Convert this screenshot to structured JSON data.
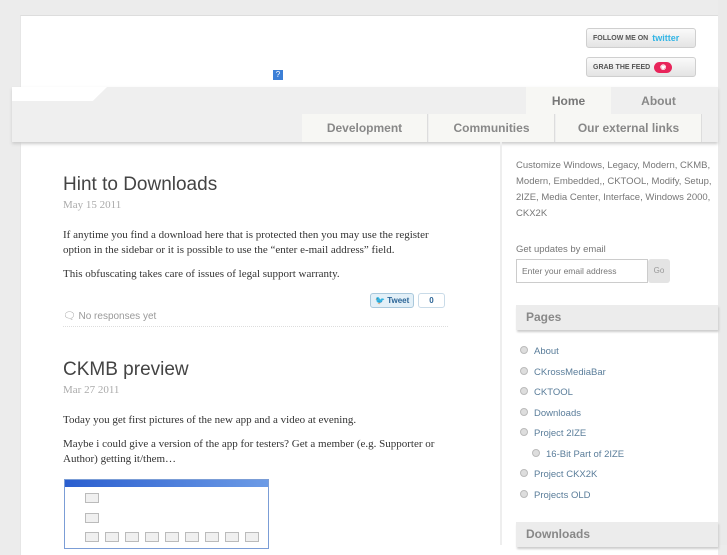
{
  "header": {
    "twitter_label": "FOLLOW ME ON",
    "twitter_brand": "twitter",
    "feed_label": "GRAB THE FEED",
    "feed_icon": "rss-icon",
    "broken_image": "?"
  },
  "nav": {
    "tabs": [
      "Home",
      "About"
    ],
    "subnav": [
      "Development",
      "Communities",
      "Our external links"
    ]
  },
  "posts": [
    {
      "title": "Hint to Downloads",
      "date": "May 15 2011",
      "paragraphs": [
        "If anytime you find a download here that is protected then you may use the register option in the sidebar or it is possible to use the “enter e-mail address” field.",
        "This obfuscating takes care of issues of legal support warranty."
      ],
      "tweet": "Tweet",
      "tweet_count": "0",
      "responses": "No responses yet"
    },
    {
      "title": "CKMB preview",
      "date": "Mar 27 2011",
      "paragraphs": [
        "Today you get first pictures of the new app and a video at evening.",
        "Maybe i could give a version of the app for testers? Get a member (e.g. Supporter or Author) getting it/them…"
      ]
    }
  ],
  "sidebar": {
    "description": "Customize Windows, Legacy, Modern, CKMB, Modern, Embedded,, CKTOOL, Modify, Setup, 2IZE, Media Center, Interface, Windows 2000, CKX2K",
    "email_label": "Get updates by email",
    "email_placeholder": "Enter your email address",
    "go": "Go",
    "pages_title": "Pages",
    "pages": [
      "About",
      "CKrossMediaBar",
      "CKTOOL",
      "Downloads",
      "Project 2IZE",
      "16-Bit Part of 2IZE",
      "Project CKX2K",
      "Projects OLD"
    ],
    "downloads_title": "Downloads"
  }
}
